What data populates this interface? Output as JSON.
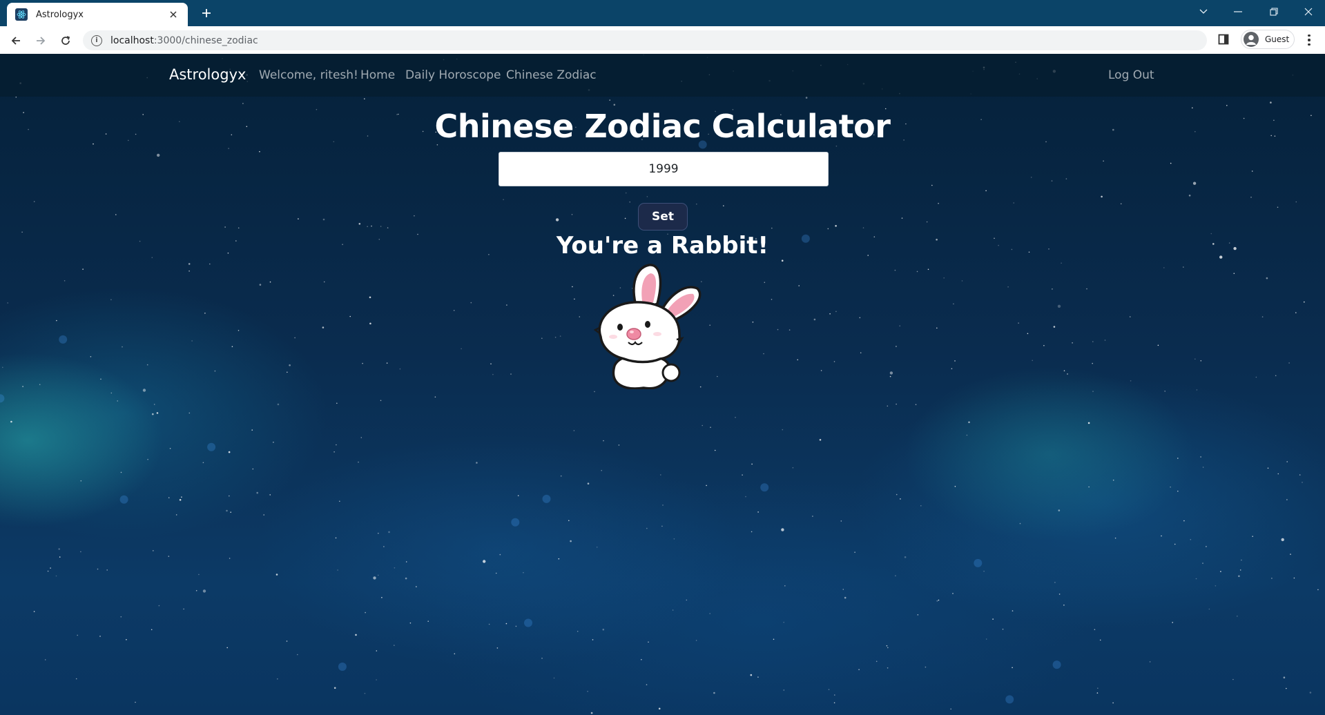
{
  "browser": {
    "tab_title": "Astrologyx",
    "new_tab_symbol": "+",
    "url_host": "localhost",
    "url_path": ":3000/chinese_zodiac",
    "profile_label": "Guest",
    "icons": [
      "react-favicon-icon",
      "close-icon",
      "plus-icon",
      "chevron-down-icon",
      "minimize-icon",
      "restore-icon",
      "window-close-icon",
      "back-arrow-icon",
      "forward-arrow-icon",
      "reload-icon",
      "info-icon",
      "side-panel-icon",
      "profile-avatar-icon",
      "kebab-menu-icon"
    ]
  },
  "navbar": {
    "brand": "Astrologyx",
    "welcome": "Welcome, ritesh!",
    "links": [
      "Home",
      "Daily Horoscope",
      "Chinese Zodiac"
    ],
    "logout": "Log Out"
  },
  "main": {
    "title": "Chinese Zodiac Calculator",
    "year_value": "1999",
    "set_label": "Set",
    "result": "You're a Rabbit!",
    "zodiac_image": "rabbit-illustration"
  },
  "colors": {
    "tabbar": "#0b4468",
    "navbar": "#051e30",
    "button": "#1c2a4a",
    "page_bg": "#0a2c4f"
  }
}
